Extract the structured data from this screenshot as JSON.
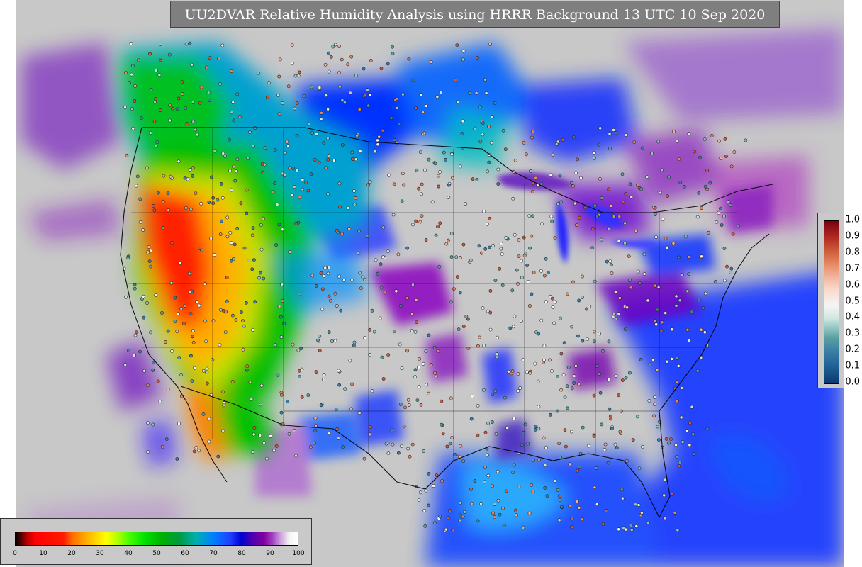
{
  "title": "UU2DVAR Relative Humidity Analysis using HRRR Background 13 UTC 10 Sep 2020",
  "rh_colorbar": {
    "ticks": [
      "0",
      "10",
      "20",
      "30",
      "40",
      "50",
      "60",
      "70",
      "80",
      "90",
      "100"
    ],
    "range": [
      0,
      100
    ]
  },
  "obs_colorbar": {
    "ticks": [
      "0.0",
      "0.1",
      "0.2",
      "0.3",
      "0.4",
      "0.5",
      "0.6",
      "0.7",
      "0.8",
      "0.9",
      "1.0"
    ],
    "range": [
      0,
      1
    ]
  },
  "colors": {
    "background_fill": "#c8c8c8",
    "dry": "#ff0000",
    "moist": "#0000d0",
    "saturated": "#d0d0d0"
  }
}
